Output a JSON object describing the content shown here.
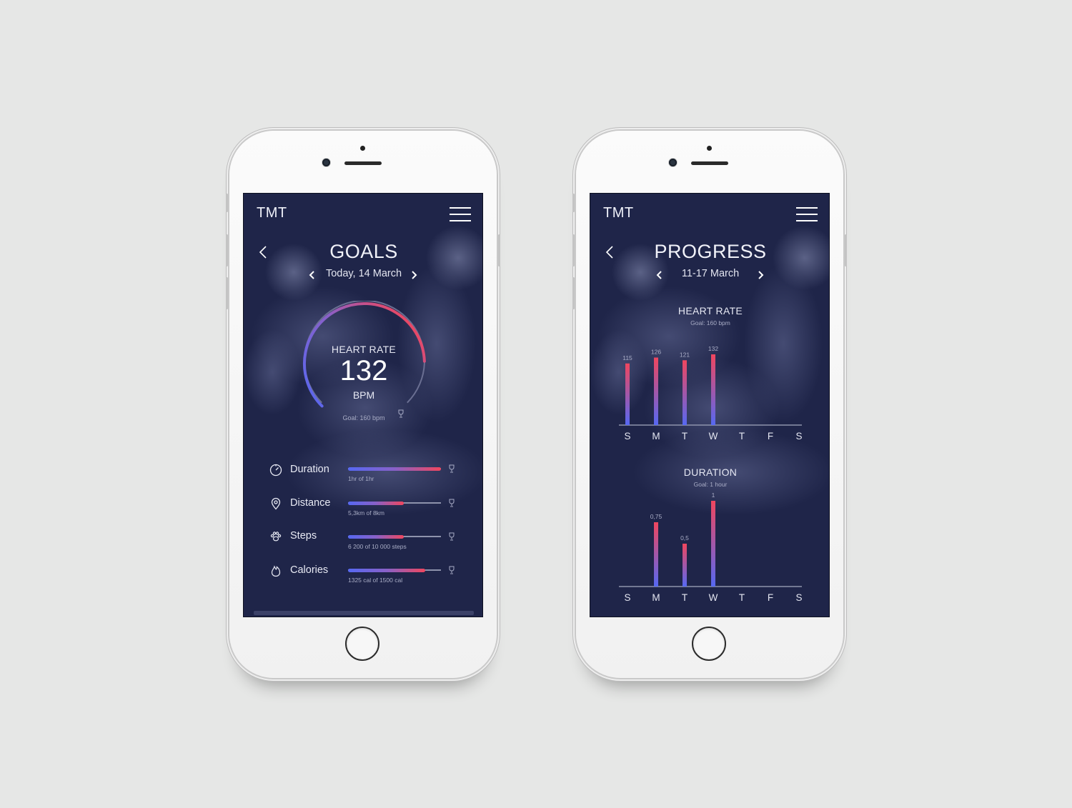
{
  "colors": {
    "screen_bg": "#1f2549",
    "gradient_start": "#5668f2",
    "gradient_end": "#f0465e",
    "text": "#e8eaf4",
    "muted_text": "#a9adc6"
  },
  "goals": {
    "brand": "TMT",
    "title": "GOALS",
    "date": "Today, 14 March",
    "icons": {
      "menu": "hamburger-menu-icon",
      "back": "chevron-left-icon",
      "prev": "chevron-left-icon",
      "next": "chevron-right-icon"
    },
    "heart_rate": {
      "label": "HEART RATE",
      "value": "132",
      "unit": "BPM",
      "goal": "Goal: 160 bpm",
      "progress": 0.825
    },
    "metrics": [
      {
        "label": "Duration",
        "sub": "1hr of 1hr",
        "progress": 1.0,
        "icon": "stopwatch-icon"
      },
      {
        "label": "Distance",
        "sub": "5,3km of 8km",
        "progress": 0.6,
        "icon": "location-pin-icon"
      },
      {
        "label": "Steps",
        "sub": "6 200 of 10 000 steps",
        "progress": 0.6,
        "icon": "paw-icon"
      },
      {
        "label": "Calories",
        "sub": "1325 cal of 1500 cal",
        "progress": 0.83,
        "icon": "flame-icon"
      }
    ]
  },
  "progress": {
    "brand": "TMT",
    "title": "PROGRESS",
    "date": "11-17 March",
    "icons": {
      "menu": "hamburger-menu-icon",
      "back": "chevron-left-icon",
      "prev": "chevron-left-icon",
      "next": "chevron-right-icon"
    }
  },
  "chart_data": [
    {
      "type": "bar",
      "title": "HEART RATE",
      "subtitle": "Goal: 160 bpm",
      "categories": [
        "S",
        "M",
        "T",
        "W",
        "T",
        "F",
        "S"
      ],
      "values": [
        115,
        126,
        121,
        132,
        null,
        null,
        null
      ],
      "labels": [
        "115",
        "126",
        "121",
        "132",
        "",
        "",
        ""
      ],
      "ylim": [
        0,
        160
      ],
      "grid": false,
      "legend": "none"
    },
    {
      "type": "bar",
      "title": "DURATION",
      "subtitle": "Goal: 1 hour",
      "categories": [
        "S",
        "M",
        "T",
        "W",
        "T",
        "F",
        "S"
      ],
      "values": [
        null,
        0.75,
        0.5,
        1,
        null,
        null,
        null
      ],
      "labels": [
        "",
        "0,75",
        "0,5",
        "1",
        "",
        "",
        ""
      ],
      "ylim": [
        0,
        1
      ],
      "grid": false,
      "legend": "none"
    }
  ]
}
